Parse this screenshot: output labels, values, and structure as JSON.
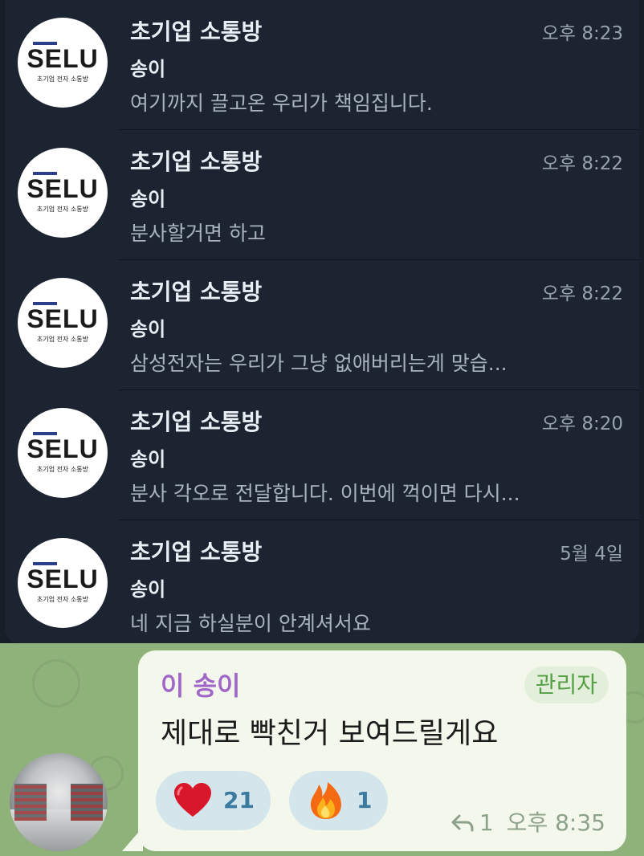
{
  "notifications": [
    {
      "group": "초기업 소통방",
      "sender": "송이",
      "message": "여기까지 끌고온 우리가 책임집니다.",
      "time": "오후 8:23",
      "avatar_logo": "SELU",
      "avatar_sub": "초기업 전자 소통방"
    },
    {
      "group": "초기업 소통방",
      "sender": "송이",
      "message": "분사할거면 하고",
      "time": "오후 8:22",
      "avatar_logo": "SELU",
      "avatar_sub": "초기업 전자 소통방"
    },
    {
      "group": "초기업 소통방",
      "sender": "송이",
      "message": "삼성전자는 우리가 그냥 없애버리는게 맞습...",
      "time": "오후 8:22",
      "avatar_logo": "SELU",
      "avatar_sub": "초기업 전자 소통방"
    },
    {
      "group": "초기업 소통방",
      "sender": "송이",
      "message": "분사 각오로 전달합니다. 이번에 꺽이면 다시...",
      "time": "오후 8:20",
      "avatar_logo": "SELU",
      "avatar_sub": "초기업 전자 소통방"
    },
    {
      "group": "초기업 소통방",
      "sender": "송이",
      "message": "네 지금 하실분이 안계셔서요",
      "time": "5월 4일",
      "avatar_logo": "SELU",
      "avatar_sub": "초기업 전자 소통방"
    }
  ],
  "chat": {
    "sender_name": "이 송이",
    "role_badge": "관리자",
    "message": "제대로 빡친거 보여드릴게요",
    "reactions": [
      {
        "emoji": "heart-icon",
        "count": "21"
      },
      {
        "emoji": "fire-icon",
        "count": "1"
      }
    ],
    "reply_count": "1",
    "time": "오후 8:35"
  },
  "colors": {
    "notif_bg": "#1b2430",
    "chat_bg": "#8fb27b",
    "bubble_bg": "#f4f8ec",
    "sender_name": "#a066c8",
    "role_badge": "#55a046",
    "reaction_count": "#3d7aa0"
  }
}
